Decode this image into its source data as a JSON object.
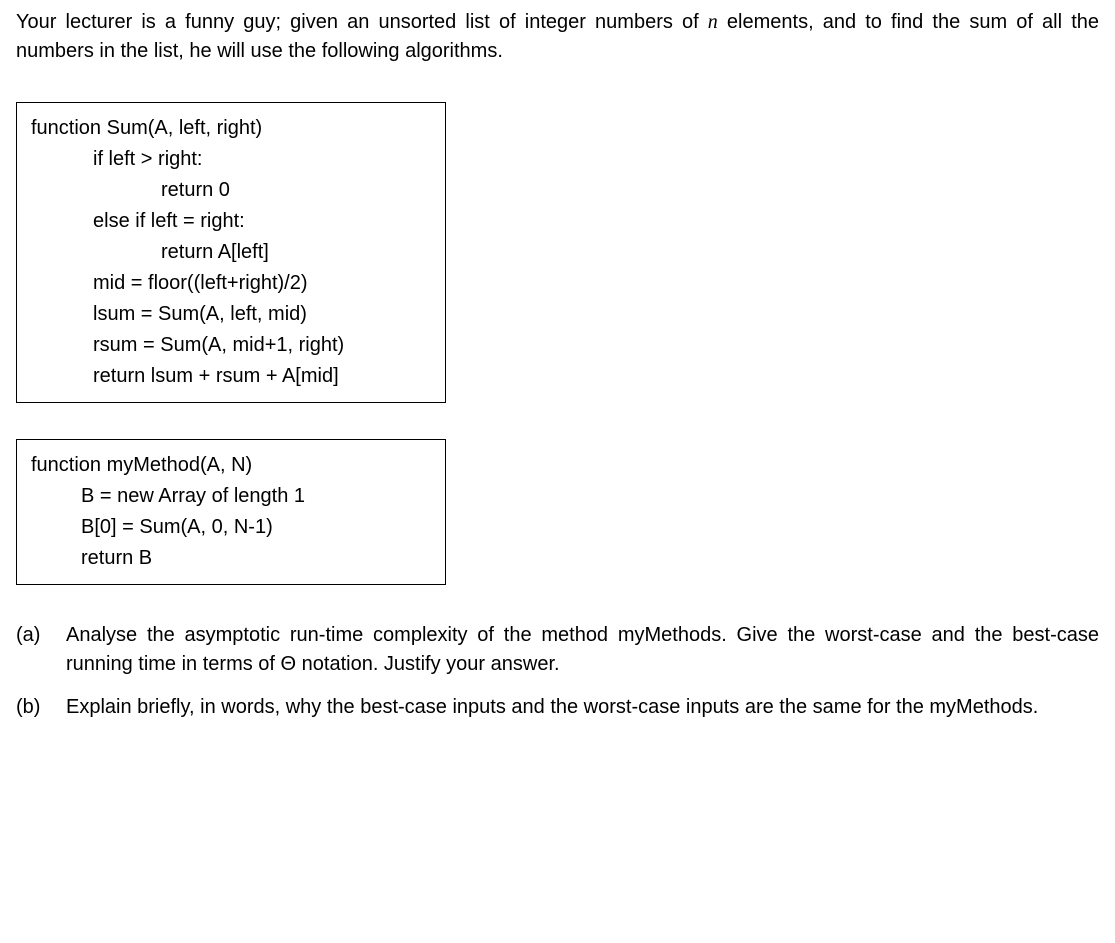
{
  "intro_part1": "Your lecturer is a funny guy; given an unsorted list of integer numbers of ",
  "intro_n": "n",
  "intro_part2": " elements, and to find the sum of all the numbers in the list, he will use the following algorithms.",
  "code1": {
    "l1": "function Sum(A, left, right)",
    "l2": "if left > right:",
    "l3": "return 0",
    "l4": "else if left = right:",
    "l5": "return A[left]",
    "l6": "mid = floor((left+right)/2)",
    "l7": "lsum = Sum(A, left, mid)",
    "l8": "rsum = Sum(A, mid+1, right)",
    "l9": "return lsum + rsum + A[mid]"
  },
  "code2": {
    "l1": "function myMethod(A, N)",
    "l2": "B = new Array of length 1",
    "l3": "B[0] = Sum(A, 0, N-1)",
    "l4": "return B"
  },
  "qa": {
    "label": "(a)",
    "text": "Analyse the asymptotic run-time complexity of the method myMethods. Give the worst-case and the best-case running time in terms of Θ notation. Justify your answer."
  },
  "qb": {
    "label": "(b)",
    "text": "Explain briefly, in words, why the best-case inputs and the worst-case inputs are the same for the myMethods."
  }
}
